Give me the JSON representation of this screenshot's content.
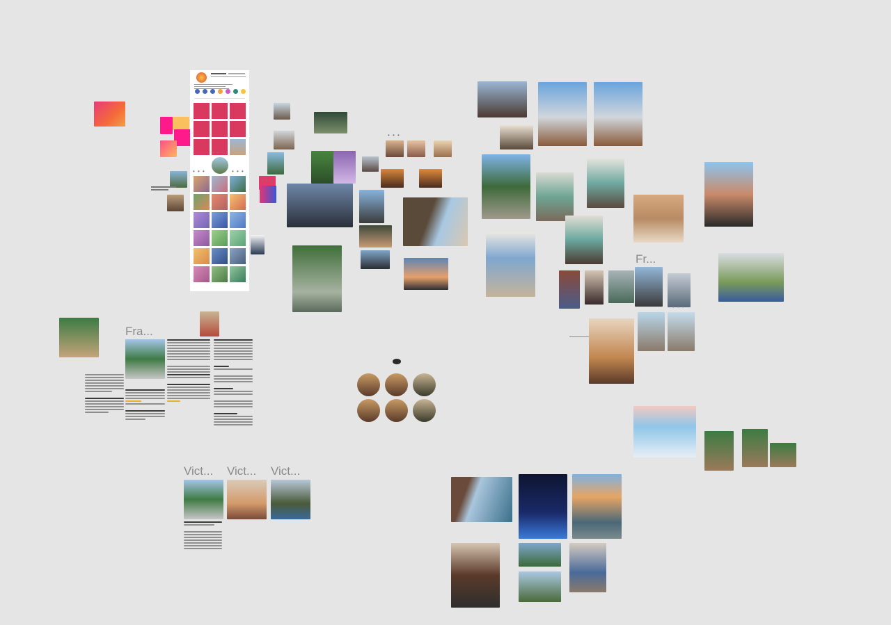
{
  "canvas": {
    "background": "#e5e5e5"
  },
  "frame_labels": {
    "fra_left": "Fra...",
    "fr_right": "Fr...",
    "vict_1": "Vict...",
    "vict_2": "Vict...",
    "vict_3": "Vict..."
  },
  "palette": {
    "pink": "#e2366a",
    "magenta": "#ff1493",
    "yellow": "#f7c15c",
    "orange": "#f39a3a",
    "sky": "#7fb4e6",
    "green": "#3f7b45",
    "dusk": "#1f2c5e"
  },
  "icons": [
    "logo-icon",
    "more-icon"
  ]
}
